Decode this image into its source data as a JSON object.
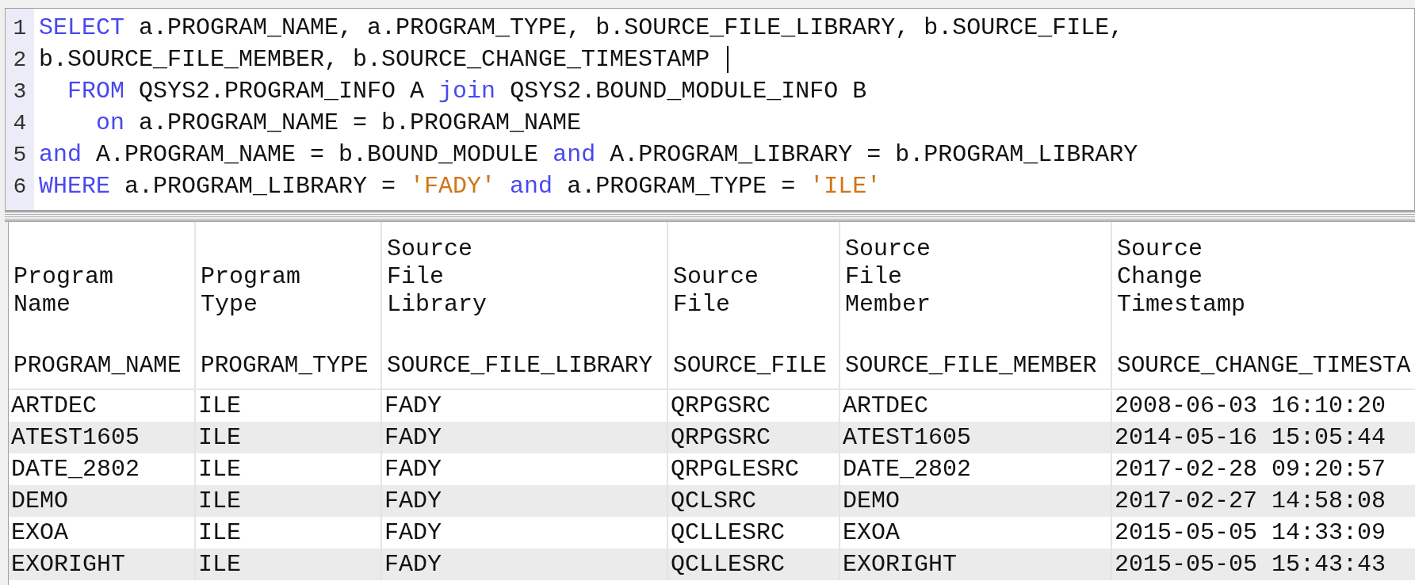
{
  "editor": {
    "lines": [
      {
        "number": "1",
        "cursor": false,
        "tokens": [
          {
            "kind": "keyword",
            "text": "SELECT"
          },
          {
            "kind": "plain",
            "text": " a.PROGRAM_NAME, a.PROGRAM_TYPE, b.SOURCE_FILE_LIBRARY, b.SOURCE_FILE,"
          }
        ]
      },
      {
        "number": "2",
        "cursor": true,
        "tokens": [
          {
            "kind": "plain",
            "text": "b.SOURCE_FILE_MEMBER, b.SOURCE_CHANGE_TIMESTAMP "
          }
        ]
      },
      {
        "number": "3",
        "cursor": false,
        "tokens": [
          {
            "kind": "keyword",
            "text": "  FROM"
          },
          {
            "kind": "plain",
            "text": " QSYS2.PROGRAM_INFO A "
          },
          {
            "kind": "keyword",
            "text": "join"
          },
          {
            "kind": "plain",
            "text": " QSYS2.BOUND_MODULE_INFO B"
          }
        ]
      },
      {
        "number": "4",
        "cursor": false,
        "tokens": [
          {
            "kind": "keyword",
            "text": "    on"
          },
          {
            "kind": "plain",
            "text": " a.PROGRAM_NAME = b.PROGRAM_NAME"
          }
        ]
      },
      {
        "number": "5",
        "cursor": false,
        "tokens": [
          {
            "kind": "keyword",
            "text": "and"
          },
          {
            "kind": "plain",
            "text": " A.PROGRAM_NAME = b.BOUND_MODULE "
          },
          {
            "kind": "keyword",
            "text": "and"
          },
          {
            "kind": "plain",
            "text": " A.PROGRAM_LIBRARY = b.PROGRAM_LIBRARY"
          }
        ]
      },
      {
        "number": "6",
        "cursor": false,
        "tokens": [
          {
            "kind": "keyword",
            "text": "WHERE"
          },
          {
            "kind": "plain",
            "text": " a.PROGRAM_LIBRARY = "
          },
          {
            "kind": "string",
            "text": "'FADY'"
          },
          {
            "kind": "keyword",
            "text": " and"
          },
          {
            "kind": "plain",
            "text": " a.PROGRAM_TYPE = "
          },
          {
            "kind": "string",
            "text": "'ILE'"
          }
        ]
      }
    ]
  },
  "results": {
    "columns": [
      {
        "label": [
          "Program",
          "Name"
        ],
        "field": "PROGRAM_NAME"
      },
      {
        "label": [
          "Program",
          "Type"
        ],
        "field": "PROGRAM_TYPE"
      },
      {
        "label": [
          "Source",
          "File",
          "Library"
        ],
        "field": "SOURCE_FILE_LIBRARY"
      },
      {
        "label": [
          "Source",
          "File"
        ],
        "field": "SOURCE_FILE"
      },
      {
        "label": [
          "Source",
          "File",
          "Member"
        ],
        "field": "SOURCE_FILE_MEMBER"
      },
      {
        "label": [
          "Source",
          "Change",
          "Timestamp"
        ],
        "field": "SOURCE_CHANGE_TIMESTA"
      }
    ],
    "rows": [
      [
        "ARTDEC",
        "ILE",
        "FADY",
        "QRPGSRC",
        "ARTDEC",
        "2008-06-03 16:10:20"
      ],
      [
        "ATEST1605",
        "ILE",
        "FADY",
        "QRPGSRC",
        "ATEST1605",
        "2014-05-16 15:05:44"
      ],
      [
        "DATE_2802",
        "ILE",
        "FADY",
        "QRPGLESRC",
        "DATE_2802",
        "2017-02-28 09:20:57"
      ],
      [
        "DEMO",
        "ILE",
        "FADY",
        "QCLSRC",
        "DEMO",
        "2017-02-27 14:58:08"
      ],
      [
        "EXOA",
        "ILE",
        "FADY",
        "QCLLESRC",
        "EXOA",
        "2015-05-05 14:33:09"
      ],
      [
        "EXORIGHT",
        "ILE",
        "FADY",
        "QCLLESRC",
        "EXORIGHT",
        "2015-05-05 15:43:43"
      ]
    ]
  }
}
